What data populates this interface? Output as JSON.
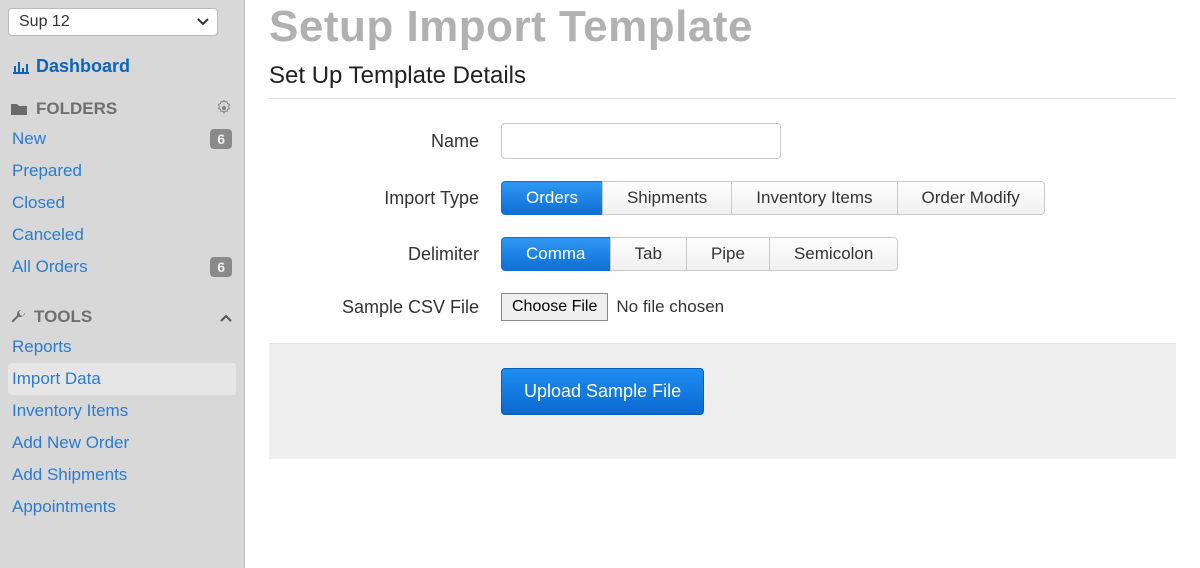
{
  "sidebar": {
    "org_selector_value": "Sup 12",
    "dashboard_label": "Dashboard",
    "folders": {
      "header_label": "FOLDERS",
      "items": [
        {
          "label": "New",
          "badge": "6"
        },
        {
          "label": "Prepared",
          "badge": ""
        },
        {
          "label": "Closed",
          "badge": ""
        },
        {
          "label": "Canceled",
          "badge": ""
        },
        {
          "label": "All Orders",
          "badge": "6"
        }
      ]
    },
    "tools": {
      "header_label": "TOOLS",
      "items": [
        {
          "label": "Reports"
        },
        {
          "label": "Import Data"
        },
        {
          "label": "Inventory Items"
        },
        {
          "label": "Add New Order"
        },
        {
          "label": "Add Shipments"
        },
        {
          "label": "Appointments"
        }
      ],
      "active_index": 1
    }
  },
  "main": {
    "page_title": "Setup Import Template",
    "subheading": "Set Up Template Details",
    "form": {
      "name": {
        "label": "Name",
        "value": ""
      },
      "import_type": {
        "label": "Import Type",
        "options": [
          "Orders",
          "Shipments",
          "Inventory Items",
          "Order Modify"
        ],
        "selected_index": 0
      },
      "delimiter": {
        "label": "Delimiter",
        "options": [
          "Comma",
          "Tab",
          "Pipe",
          "Semicolon"
        ],
        "selected_index": 0
      },
      "sample_csv": {
        "label": "Sample CSV File",
        "choose_button_label": "Choose File",
        "status_text": "No file chosen"
      }
    },
    "action_button_label": "Upload Sample File"
  }
}
